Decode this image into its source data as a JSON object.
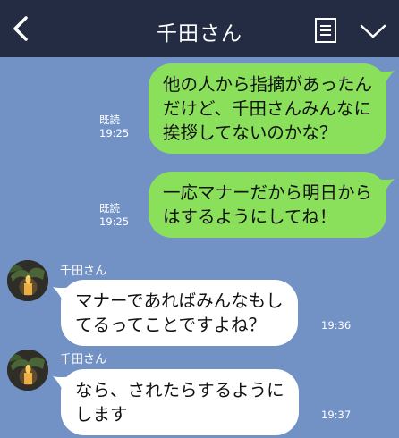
{
  "header": {
    "title": "千田さん",
    "icons": {
      "back": "chevron-left-icon",
      "notes": "notes-icon",
      "menu": "chevron-down-icon"
    },
    "colors": {
      "background": "#232c43",
      "text": "#ffffff"
    }
  },
  "chat": {
    "background": "#7291c4",
    "messages": [
      {
        "side": "right",
        "lines": [
          "他の人から指摘があったん",
          "だけど、千田さんみんなに",
          "挨拶してないのかな？"
        ],
        "read": "既読",
        "time": "19:25",
        "color": "#8ae05b"
      },
      {
        "side": "right",
        "lines": [
          "一応マナーだから明日から",
          "はするようにしてね！"
        ],
        "read": "既読",
        "time": "19:25",
        "color": "#8ae05b"
      },
      {
        "side": "left",
        "sender": "千田さん",
        "lines": [
          "マナーであればみんなもし",
          "てるってことですよね？"
        ],
        "time": "19:36",
        "color": "#ffffff"
      },
      {
        "side": "left",
        "sender": "千田さん",
        "lines": [
          "なら、されたらするように",
          "します"
        ],
        "time": "19:37",
        "color": "#ffffff"
      }
    ]
  }
}
